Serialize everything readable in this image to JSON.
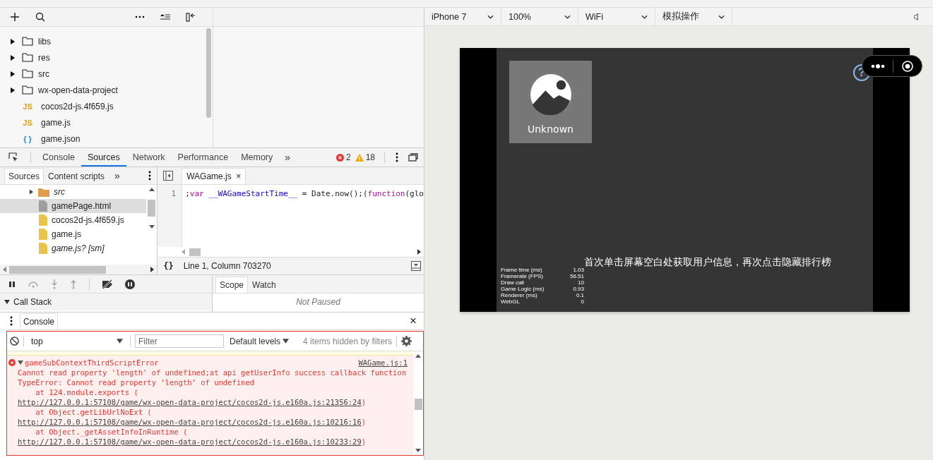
{
  "file_tree": [
    {
      "name": "libs",
      "kind": "folder",
      "expanded": false
    },
    {
      "name": "res",
      "kind": "folder",
      "expanded": false
    },
    {
      "name": "src",
      "kind": "folder",
      "expanded": false
    },
    {
      "name": "wx-open-data-project",
      "kind": "folder",
      "expanded": false
    },
    {
      "name": "cocos2d-js.4f659.js",
      "kind": "js",
      "badge": "JS"
    },
    {
      "name": "game.js",
      "kind": "js",
      "badge": "JS"
    },
    {
      "name": "game.json",
      "kind": "json",
      "badge": "{ }"
    }
  ],
  "devtools": {
    "tabs": [
      {
        "label": "Console",
        "selected": false
      },
      {
        "label": "Sources",
        "selected": true
      },
      {
        "label": "Network",
        "selected": false
      },
      {
        "label": "Performance",
        "selected": false
      },
      {
        "label": "Memory",
        "selected": false
      }
    ],
    "more": "»",
    "errors": "2",
    "warnings": "18"
  },
  "navigator": {
    "tabs": [
      {
        "label": "Sources",
        "selected": true
      },
      {
        "label": "Content scripts",
        "selected": false
      }
    ],
    "more": "»",
    "items": [
      {
        "name": "src",
        "kind": "folder",
        "italic": true,
        "selected": false
      },
      {
        "name": "gamePage.html",
        "kind": "html",
        "italic": false,
        "selected": true
      },
      {
        "name": "cocos2d-js.4f659.js",
        "kind": "script",
        "italic": false,
        "selected": false
      },
      {
        "name": "game.js",
        "kind": "script",
        "italic": false,
        "selected": false
      },
      {
        "name": "game.js? [sm]",
        "kind": "script",
        "italic": true,
        "selected": false
      }
    ]
  },
  "editor": {
    "tabs": [
      {
        "label": "WAGame.js",
        "selected": true,
        "close": "×"
      }
    ],
    "line_number": "1",
    "tokens": [
      {
        "text": ";",
        "kind": "plain"
      },
      {
        "text": "var",
        "kind": "keyword"
      },
      {
        "text": " __WAGameStartTime__",
        "kind": "variable"
      },
      {
        "text": " = Date.now();(",
        "kind": "plain"
      },
      {
        "text": "function",
        "kind": "keyword"
      },
      {
        "text": "(glo",
        "kind": "plain"
      }
    ],
    "format_button": "{}",
    "status": "Line 1, Column 703270"
  },
  "debugger": {
    "call_stack": {
      "label": "Call Stack",
      "expanded": true
    },
    "side_tabs": [
      {
        "label": "Scope",
        "selected": true
      },
      {
        "label": "Watch",
        "selected": false
      }
    ],
    "status": "Not Paused"
  },
  "console": {
    "tab": "Console",
    "close": "×",
    "context": "top",
    "filter_placeholder": "Filter",
    "levels": "Default levels",
    "hidden_note": "4 items hidden by filters",
    "message": {
      "title": "gameSubContextThirdScriptError",
      "expanded": true,
      "source": "WAGame.js:1",
      "lines": [
        "Cannot read property 'length' of undefined;at api getUserInfo success callback function",
        "TypeError: Cannot read property 'length' of undefined"
      ],
      "frames": [
        {
          "text": "at 124.module.exports (",
          "link": "http://127.0.0.1:57108/game/wx-open-data-project/cocos2d-js.e160a.js:21356:24",
          "end": ")"
        },
        {
          "text": "at Object.getLibUrlNoExt (",
          "link": "http://127.0.0.1:57108/game/wx-open-data-project/cocos2d-js.e160a.js:10216:16",
          "end": ")"
        },
        {
          "text": "at Object._getAssetInfoInRuntime (",
          "link": "http://127.0.0.1:57108/game/wx-open-data-project/cocos2d-js.e160a.js:10233:29",
          "end": ")"
        }
      ]
    }
  },
  "simulator": {
    "toolbar": [
      {
        "label": "iPhone 7"
      },
      {
        "label": "100%"
      },
      {
        "label": "WiFi"
      },
      {
        "label": "模拟操作"
      }
    ],
    "game": {
      "user_name": "Unknown",
      "hint": "首次单击屏幕空白处获取用户信息，再次点击隐藏排行榜",
      "help": "?",
      "stats": [
        {
          "label": "Frame time (ms)",
          "value": "1.03"
        },
        {
          "label": "Framerate (FPS)",
          "value": "56.51"
        },
        {
          "label": "Draw call",
          "value": "10"
        },
        {
          "label": "Game Logic (ms)",
          "value": "0.93"
        },
        {
          "label": "Renderer (ms)",
          "value": "0.1"
        },
        {
          "label": "WebGL",
          "value": "0"
        }
      ]
    }
  }
}
